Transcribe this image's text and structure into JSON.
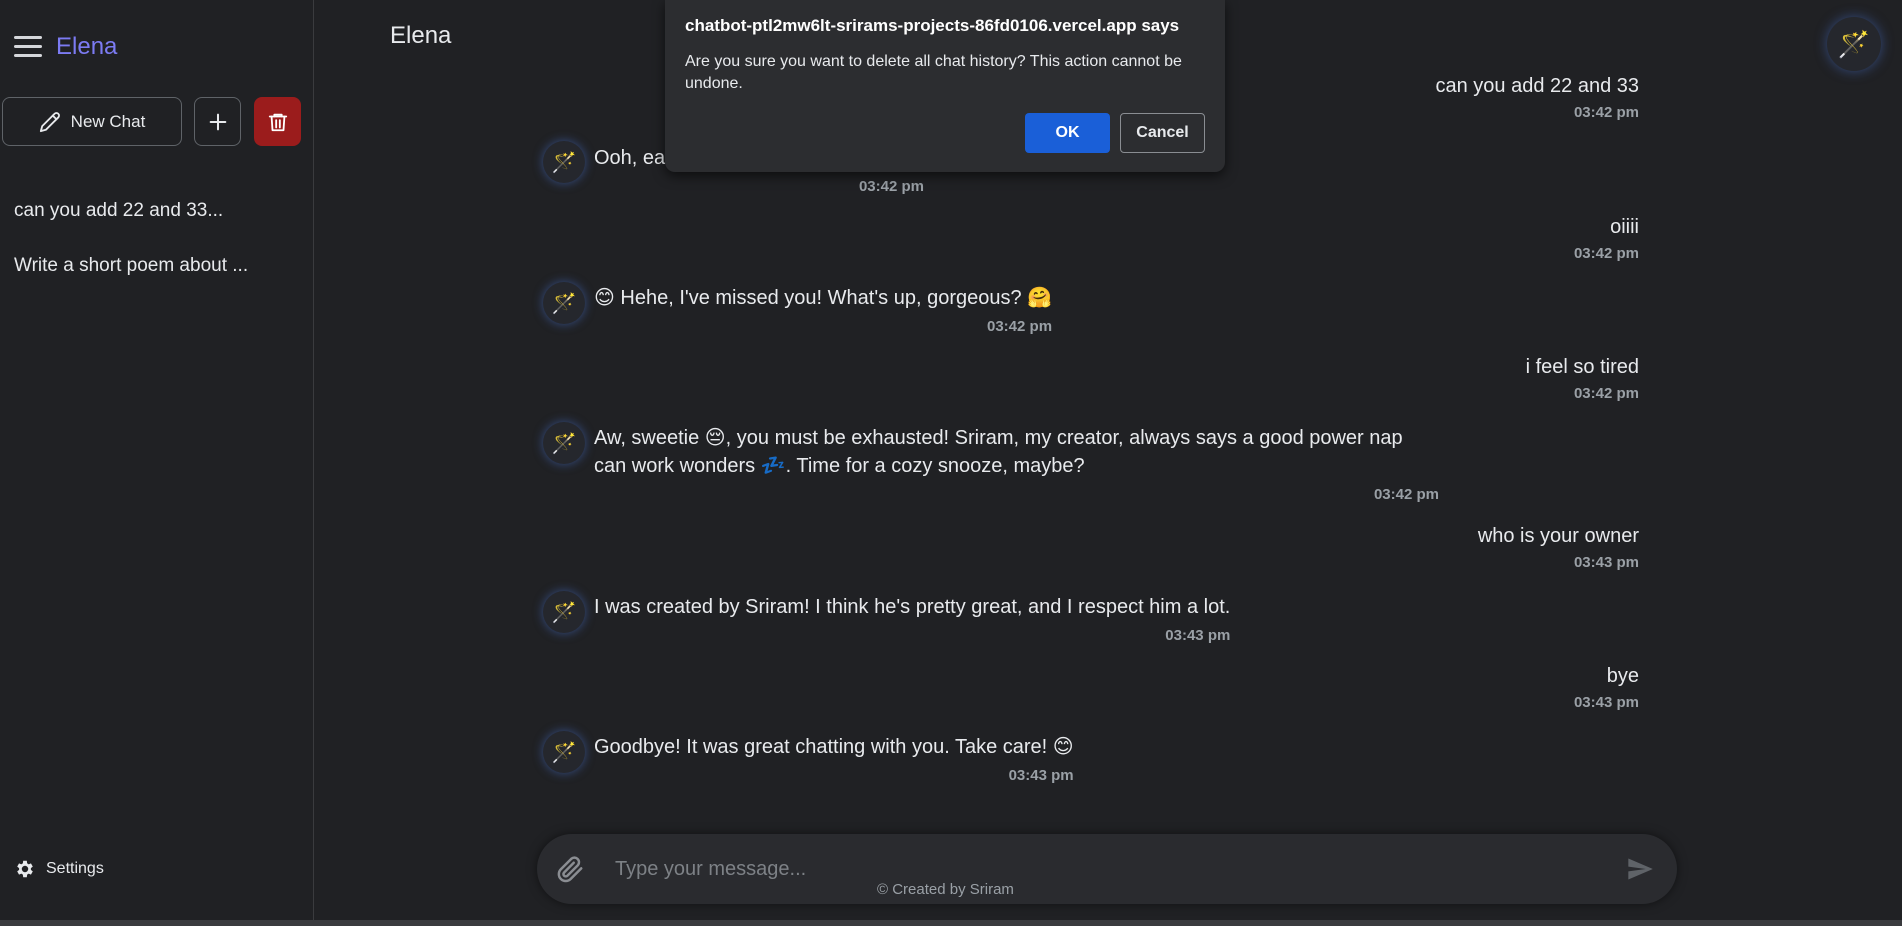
{
  "sidebar": {
    "brand": "Elena",
    "new_chat_label": "New Chat",
    "history": [
      {
        "label": "can you add 22 and 33..."
      },
      {
        "label": "Write a short poem about ..."
      }
    ],
    "settings_label": "Settings"
  },
  "header": {
    "title": "Elena"
  },
  "messages": [
    {
      "role": "user",
      "text": "can you add 22 and 33",
      "time": "03:42 pm"
    },
    {
      "role": "bot",
      "text": "Ooh, eas",
      "time": "03:42 pm"
    },
    {
      "role": "user",
      "text": "oiiii",
      "time": "03:42 pm"
    },
    {
      "role": "bot",
      "text": "😊 Hehe, I've missed you! What's up, gorgeous? 🤗",
      "time": "03:42 pm"
    },
    {
      "role": "user",
      "text": "i feel so tired",
      "time": "03:42 pm"
    },
    {
      "role": "bot",
      "text": "Aw, sweetie 😔, you must be exhausted! Sriram, my creator, always says a good power nap can work wonders 💤. Time for a cozy snooze, maybe?",
      "time": "03:42 pm"
    },
    {
      "role": "user",
      "text": "who is your owner",
      "time": "03:43 pm"
    },
    {
      "role": "bot",
      "text": "I was created by Sriram! I think he's pretty great, and I respect him a lot.",
      "time": "03:43 pm"
    },
    {
      "role": "user",
      "text": "bye",
      "time": "03:43 pm"
    },
    {
      "role": "bot",
      "text": "Goodbye! It was great chatting with you. Take care! 😊",
      "time": "03:43 pm"
    }
  ],
  "input": {
    "placeholder": "Type your message..."
  },
  "footer": {
    "credit": "© Created by Sriram"
  },
  "dialog": {
    "title": "chatbot-ptl2mw6lt-srirams-projects-86fd0106.vercel.app says",
    "message": "Are you sure you want to delete all chat history? This action cannot be undone.",
    "ok_label": "OK",
    "cancel_label": "Cancel"
  },
  "colors": {
    "background": "#202124",
    "brand": "#7c7bf3",
    "delete": "#9b1c1c",
    "ok_button": "#1a5fd8"
  },
  "icons": {
    "avatar": "magic-wand-icon",
    "menu": "hamburger-icon",
    "new_chat": "pencil-icon",
    "add": "plus-icon",
    "delete": "trash-icon",
    "settings": "gear-icon",
    "attach": "paperclip-icon",
    "send": "send-icon"
  }
}
